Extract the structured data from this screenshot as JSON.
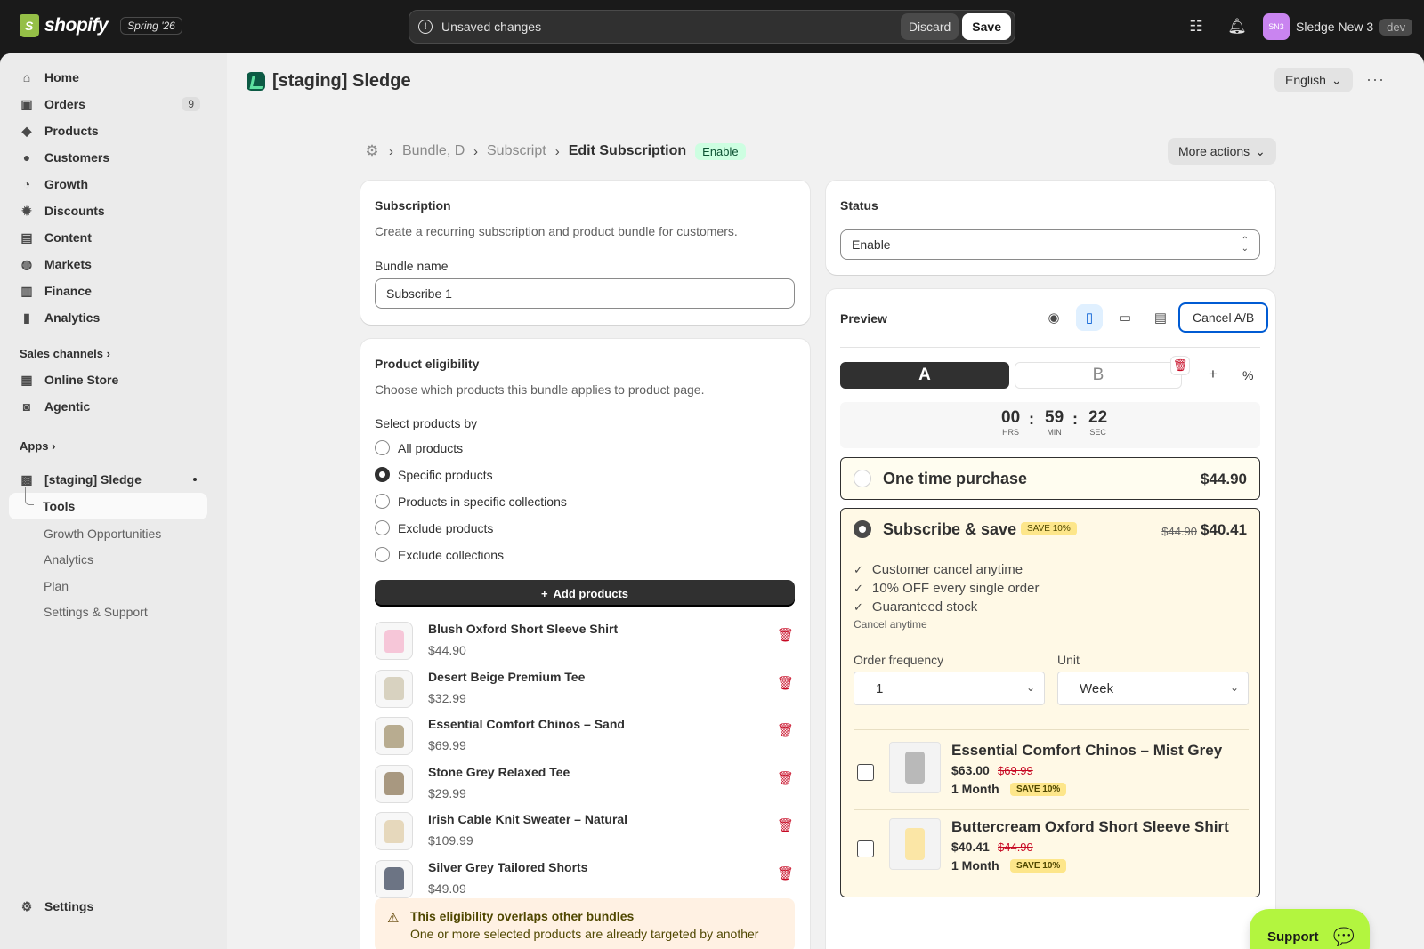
{
  "topbar": {
    "brand": "shopify",
    "version": "Spring '26",
    "unsaved": "Unsaved changes",
    "discard": "Discard",
    "save": "Save",
    "store_initials": "SN3",
    "store_name": "Sledge New 3",
    "env": "dev"
  },
  "sidebar": {
    "items": [
      {
        "label": "Home",
        "icon": "⌂"
      },
      {
        "label": "Orders",
        "icon": "▣",
        "badge": "9"
      },
      {
        "label": "Products",
        "icon": "◆"
      },
      {
        "label": "Customers",
        "icon": "●"
      },
      {
        "label": "Growth",
        "icon": "◔"
      },
      {
        "label": "Discounts",
        "icon": "✹"
      },
      {
        "label": "Content",
        "icon": "▤"
      },
      {
        "label": "Markets",
        "icon": "◍"
      },
      {
        "label": "Finance",
        "icon": "▥"
      },
      {
        "label": "Analytics",
        "icon": "▮"
      }
    ],
    "sales_channels": "Sales channels",
    "channels": [
      {
        "label": "Online Store",
        "icon": "▦"
      },
      {
        "label": "Agentic",
        "icon": "◙"
      }
    ],
    "apps": "Apps",
    "app_name": "[staging] Sledge",
    "app_subs": [
      "Tools",
      "Growth Opportunities",
      "Analytics",
      "Plan",
      "Settings & Support"
    ],
    "settings": "Settings"
  },
  "header": {
    "title": "[staging] Sledge",
    "language": "English"
  },
  "breadcrumb": {
    "items": [
      "Bundle, D",
      "Subscript"
    ],
    "current": "Edit Subscription",
    "status": "Enable",
    "more_actions": "More actions"
  },
  "subscription": {
    "title": "Subscription",
    "description": "Create a recurring subscription and product bundle for customers.",
    "bundle_label": "Bundle name",
    "bundle_value": "Subscribe 1"
  },
  "eligibility": {
    "title": "Product eligibility",
    "description": "Choose which products this bundle applies to product page.",
    "select_label": "Select products by",
    "options": [
      "All products",
      "Specific products",
      "Products in specific collections",
      "Exclude products",
      "Exclude collections"
    ],
    "selected": "Specific products",
    "add_button": "Add products",
    "products": [
      {
        "name": "Blush Oxford Short Sleeve Shirt",
        "price": "$44.90",
        "color": "#f6c6d8"
      },
      {
        "name": "Desert Beige Premium Tee",
        "price": "$32.99",
        "color": "#d8d2c0"
      },
      {
        "name": "Essential Comfort Chinos – Sand",
        "price": "$69.99",
        "color": "#b8ac90"
      },
      {
        "name": "Stone Grey Relaxed Tee",
        "price": "$29.99",
        "color": "#a89880"
      },
      {
        "name": "Irish Cable Knit Sweater – Natural",
        "price": "$109.99",
        "color": "#e6d8bc"
      },
      {
        "name": "Silver Grey Tailored Shorts",
        "price": "$49.09",
        "color": "#6c7484"
      }
    ],
    "warning_title": "This eligibility overlaps other bundles",
    "warning_text": "One or more selected products are already targeted by another"
  },
  "status": {
    "title": "Status",
    "value": "Enable"
  },
  "preview": {
    "title": "Preview",
    "cancel_ab": "Cancel A/B",
    "variant_a": "A",
    "variant_b": "B",
    "timer": {
      "hrs": "00",
      "min": "59",
      "sec": "22",
      "hrs_label": "HRS",
      "min_label": "MIN",
      "sec_label": "SEC"
    },
    "one_time": {
      "title": "One time purchase",
      "price": "$44.90"
    },
    "subscribe": {
      "title": "Subscribe & save",
      "chip": "SAVE 10%",
      "old_price": "$44.90",
      "price": "$40.41",
      "benefits": [
        "Customer cancel anytime",
        "10% OFF every single order",
        "Guaranteed stock"
      ],
      "note": "Cancel anytime",
      "freq_label": "Order frequency",
      "freq_value": "1",
      "unit_label": "Unit",
      "unit_value": "Week"
    },
    "addons": [
      {
        "name": "Essential Comfort Chinos – Mist Grey",
        "price": "$63.00",
        "old_price": "$69.99",
        "period": "1 Month",
        "chip": "SAVE 10%",
        "color": "#b9b9b9"
      },
      {
        "name": "Buttercream Oxford Short Sleeve Shirt",
        "price": "$40.41",
        "old_price": "$44.90",
        "period": "1 Month",
        "chip": "SAVE 10%",
        "color": "#fbe6a6"
      }
    ]
  },
  "support": {
    "label": "Support"
  }
}
